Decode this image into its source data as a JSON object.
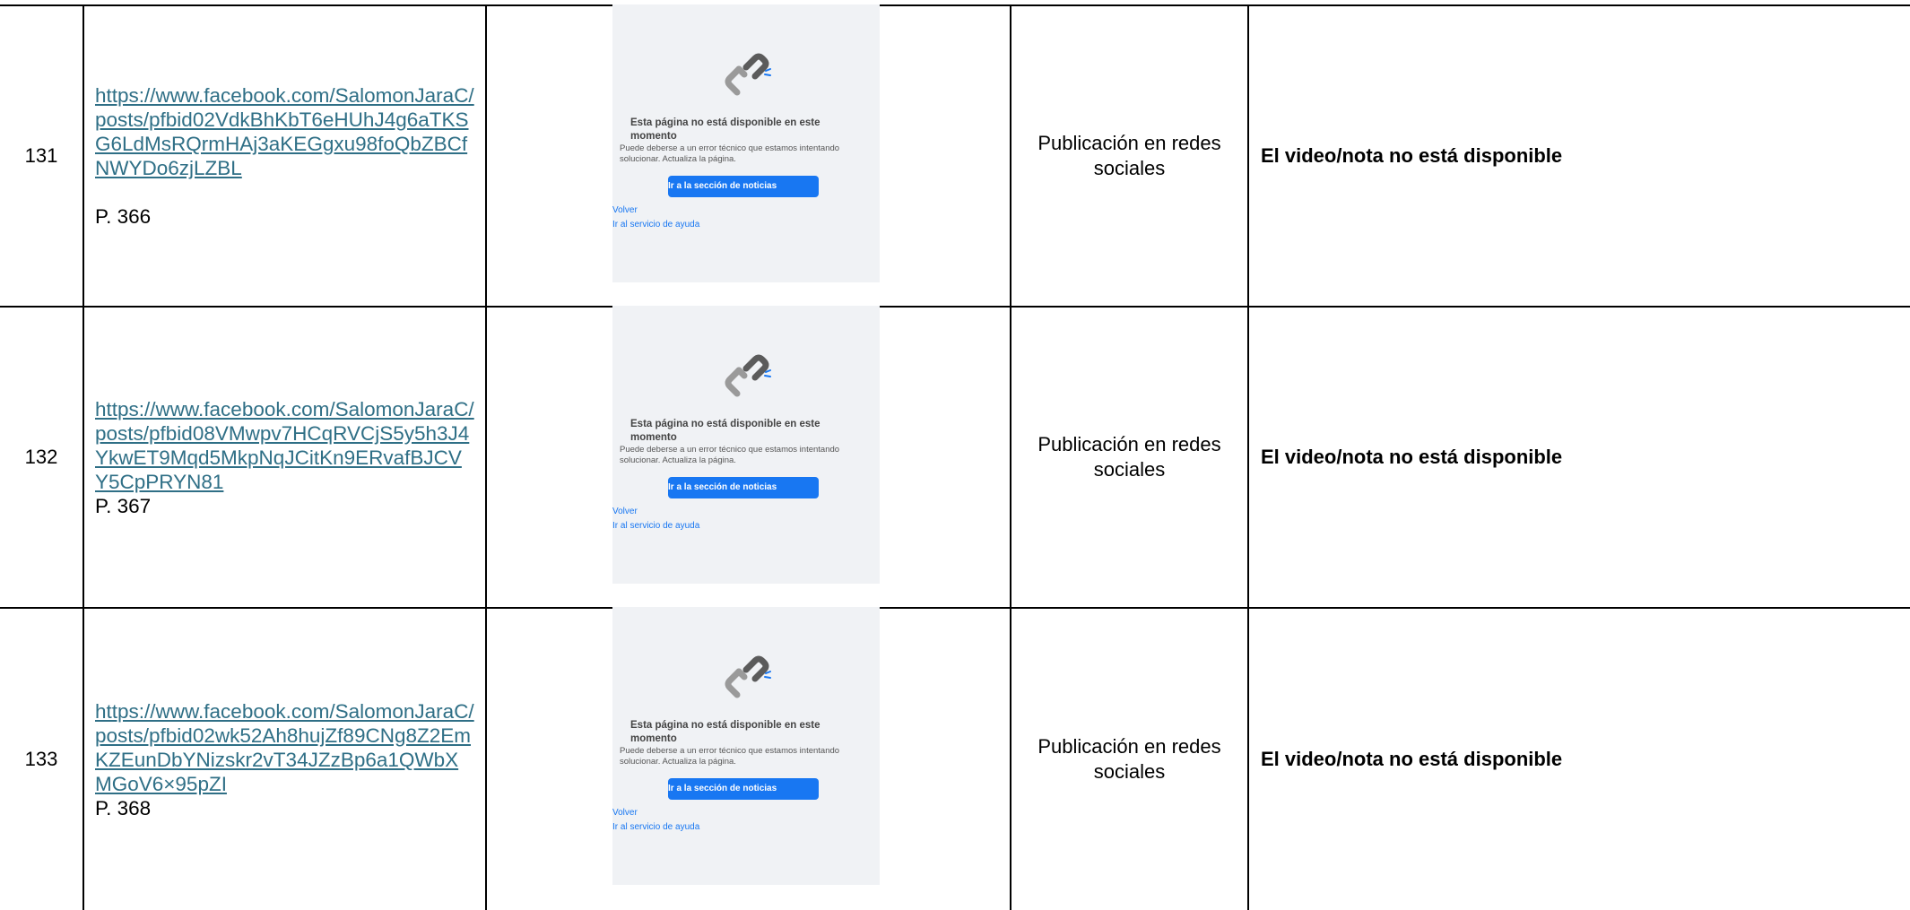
{
  "rows": [
    {
      "number": "131",
      "url": "https://www.facebook.com/SalomonJaraC/posts/pfbid02VdkBhKbT6eHUhJ4g6aTKSG6LdMsRQrmHAj3aKEGgxu98foQbZBCfNWYDo6zjLZBL",
      "page_ref": "P. 366",
      "type": "Publicación en redes sociales",
      "status": "El video/nota no está disponible"
    },
    {
      "number": "132",
      "url": "https://www.facebook.com/SalomonJaraC/posts/pfbid08VMwpv7HCqRVCjS5y5h3J4YkwET9Mqd5MkpNqJCitKn9ERvafBJCVY5CpPRYN81",
      "page_ref": "P. 367",
      "type": "Publicación en redes sociales",
      "status": "El video/nota no está disponible"
    },
    {
      "number": "133",
      "url": "https://www.facebook.com/SalomonJaraC/posts/pfbid02wk52Ah8hujZf89CNg8Z2EmKZEunDbYNizskr2vT34JZzBp6a1QWbXMGoV6×95pZI",
      "page_ref": "P. 368",
      "type": "Publicación en redes sociales",
      "status": "El video/nota no está disponible"
    }
  ],
  "unavailable_screenshot": {
    "icon": "broken-link-icon",
    "title": "Esta página no está disponible en este momento",
    "description": "Puede deberse a un error técnico que estamos intentando solucionar. Actualiza la página.",
    "button_label": "Ir a la sección de noticias",
    "back_link": "Volver",
    "help_link": "Ir al servicio de ayuda",
    "colors": {
      "background": "#f0f2f5",
      "button": "#1877f2",
      "link": "#1877f2"
    }
  },
  "colors": {
    "url_link": "#2f6f86",
    "border": "#000000"
  }
}
